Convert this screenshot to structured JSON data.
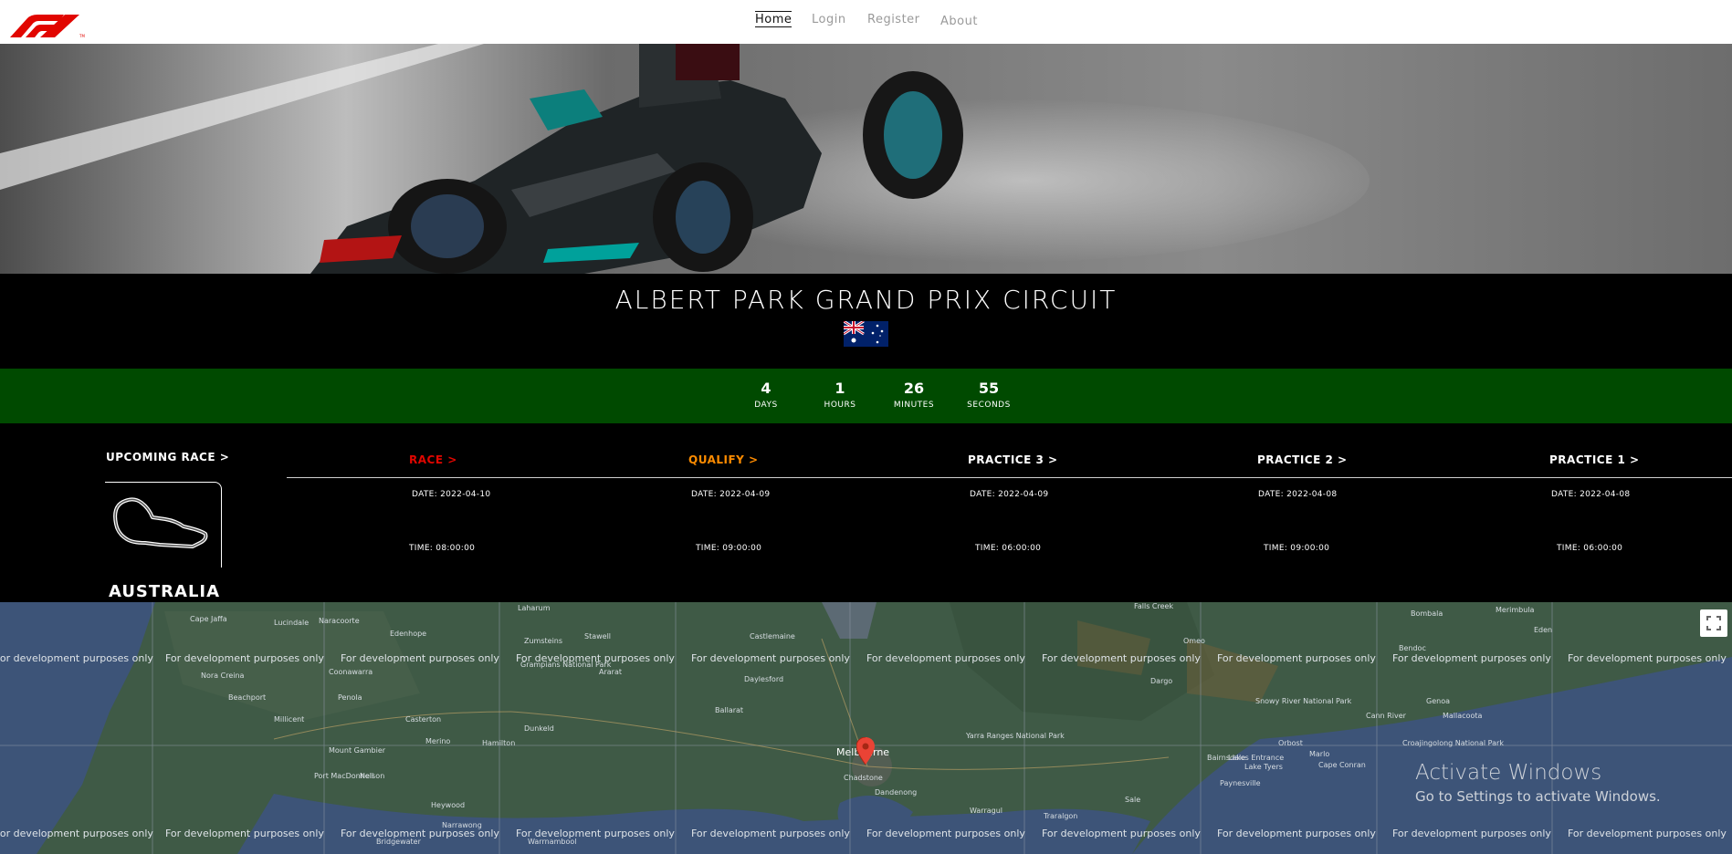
{
  "nav": {
    "home": "Home",
    "login": "Login",
    "register": "Register",
    "about": "About"
  },
  "circuit": {
    "name": "ALBERT PARK GRAND PRIX CIRCUIT",
    "country": "AUSTRALIA"
  },
  "countdown": {
    "days": "4",
    "days_label": "DAYS",
    "hours": "1",
    "hours_label": "HOURS",
    "minutes": "26",
    "minutes_label": "MINUTES",
    "seconds": "55",
    "seconds_label": "SECONDS"
  },
  "schedule": {
    "upcoming_label": "UPCOMING RACE >",
    "sessions": [
      {
        "title": "RACE >",
        "date": "DATE: 2022-04-10",
        "time": "TIME: 08:00:00",
        "color": "#e10600"
      },
      {
        "title": "QUALIFY >",
        "date": "DATE: 2022-04-09",
        "time": "TIME: 09:00:00",
        "color": "#ff8c00"
      },
      {
        "title": "PRACTICE 3 >",
        "date": "DATE: 2022-04-09",
        "time": "TIME: 06:00:00",
        "color": "#ffffff"
      },
      {
        "title": "PRACTICE 2 >",
        "date": "DATE: 2022-04-08",
        "time": "TIME: 09:00:00",
        "color": "#ffffff"
      },
      {
        "title": "PRACTICE 1 >",
        "date": "DATE: 2022-04-08",
        "time": "TIME: 06:00:00",
        "color": "#ffffff"
      }
    ]
  },
  "map": {
    "dev_watermark": "For development purposes only",
    "places": [
      "Laharum",
      "Stawell",
      "Castlemaine",
      "Falls Creek",
      "Bombala",
      "Merimbula",
      "Eden",
      "Cape Jaffa",
      "Lucindale",
      "Naracoorte",
      "Edenhope",
      "Zumsteins",
      "Grampians National Park",
      "Daylesford",
      "Omeo",
      "Bendoc",
      "Nora Creina",
      "Coonawarra",
      "Ararat",
      "Dargo",
      "Snowy River National Park",
      "Beachport",
      "Penola",
      "Ballarat",
      "Genoa",
      "Millicent",
      "Casterton",
      "Dunkeld",
      "Cann River",
      "Mallacoota",
      "Merino",
      "Hamilton",
      "Yarra Ranges National Park",
      "Mount Gambier",
      "Melbourne",
      "Bairnsdale",
      "Lakes Entrance",
      "Orbost",
      "Croajingolong National Park",
      "Port MacDonnell",
      "Nelson",
      "Chadstone",
      "Dandenong",
      "Lake Tyers",
      "Marlo",
      "Cape Conran",
      "Heywood",
      "Warragul",
      "Sale",
      "Traralgon",
      "Paynesville",
      "Narrawong",
      "Warrnambool",
      "Bridgewater"
    ],
    "activate_title": "Activate Windows",
    "activate_sub": "Go to Settings to activate Windows."
  }
}
